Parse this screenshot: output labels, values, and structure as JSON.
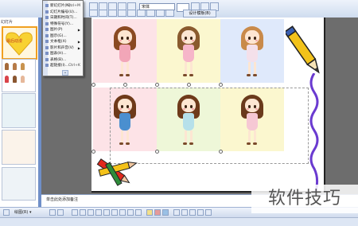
{
  "toolbar": {
    "font_value": "宋体",
    "right_button": "设计模板(B)"
  },
  "left_pane": {
    "label": "幻灯片",
    "heart_label": "最后动漫"
  },
  "context_menu": {
    "items": [
      {
        "label": "新幻灯片(N)...",
        "shortcut": "Ctrl+M"
      },
      {
        "label": "幻灯片编号(U)...",
        "shortcut": ""
      },
      {
        "label": "日期和时间(T)...",
        "shortcut": ""
      },
      {
        "label": "特殊符号(Y)...",
        "shortcut": ""
      },
      {
        "label": "图片(P)",
        "submenu": true
      },
      {
        "label": "图示(G)...",
        "shortcut": ""
      },
      {
        "label": "文本框(X)",
        "submenu": true
      },
      {
        "label": "影片和声音(V)",
        "submenu": true
      },
      {
        "label": "图表(H)...",
        "shortcut": ""
      },
      {
        "label": "表格(B)...",
        "shortcut": ""
      },
      {
        "label": "超链接(I)...",
        "shortcut": "Ctrl+K"
      }
    ],
    "expand_glyph": "⌄"
  },
  "notes": {
    "placeholder": "单击此处添加备注"
  },
  "drawbar": {
    "label": "绘图(R) ▾"
  },
  "watermark": {
    "text": "软件技巧"
  },
  "slide": {
    "cells": [
      {
        "bg": "#fde3e7",
        "hair": "#8a4a22",
        "dress": "#f2a6b8"
      },
      {
        "bg": "#fbf7cf",
        "hair": "#8a5a2e",
        "dress": "#f6b6c9"
      },
      {
        "bg": "#dfe9fb",
        "hair": "#c98a4a",
        "dress": "#f4e0ea"
      },
      {
        "bg": "#fde3e7",
        "hair": "#6e3a1a",
        "dress": "#4a8fcf"
      },
      {
        "bg": "#eef7d8",
        "hair": "#6e3a1a",
        "dress": "#b6e0ea"
      },
      {
        "bg": "#fbf7cf",
        "hair": "#6a3a1c",
        "dress": "#f6c8d4"
      }
    ]
  }
}
